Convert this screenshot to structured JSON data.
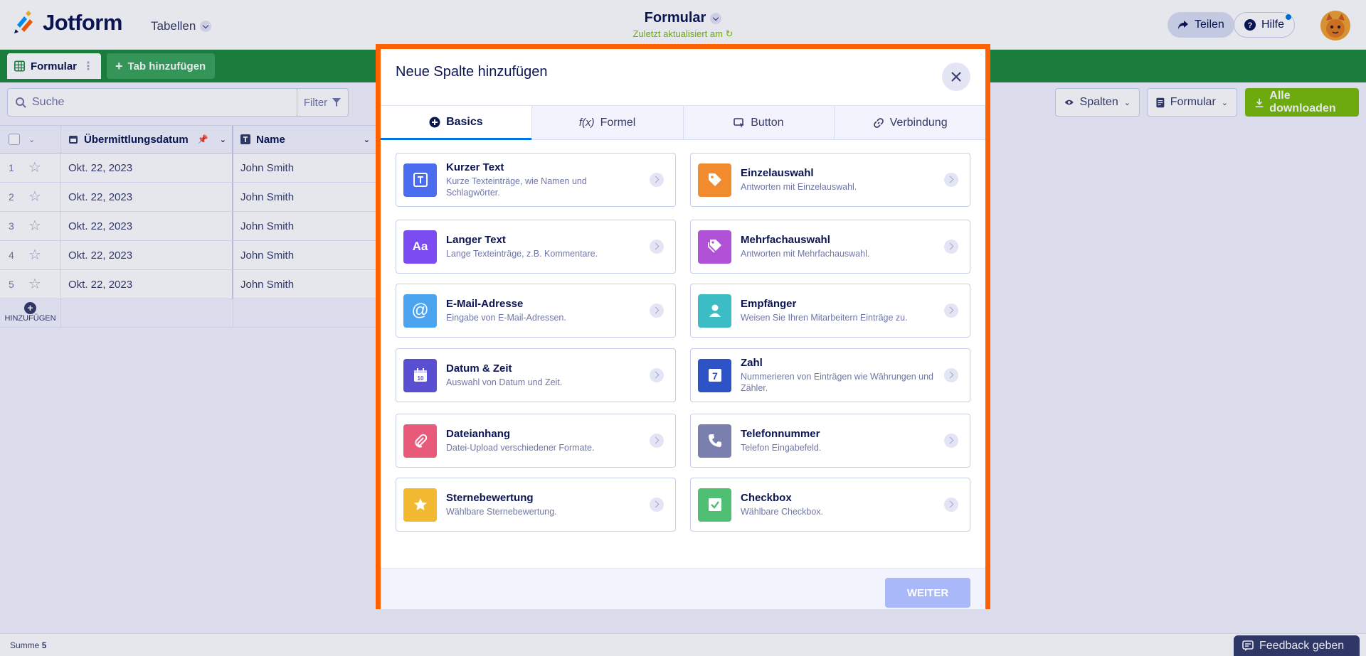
{
  "header": {
    "logo_text": "Jotform",
    "tables_menu": "Tabellen",
    "form_title": "Formular",
    "saved_status": "Zuletzt aktualisiert am",
    "share_label": "Teilen",
    "help_label": "Hilfe"
  },
  "tabs": {
    "current": "Formular",
    "add_label": "Tab hinzufügen"
  },
  "toolbar": {
    "search_placeholder": "Suche",
    "filter_label": "Filter",
    "columns_label": "Spalten",
    "form_view_label": "Formular",
    "download_label": "Alle downloaden"
  },
  "table": {
    "columns": [
      "Übermittlungsdatum",
      "Name"
    ],
    "rows": [
      {
        "num": "1",
        "date": "Okt. 22, 2023",
        "name": "John Smith"
      },
      {
        "num": "2",
        "date": "Okt. 22, 2023",
        "name": "John Smith"
      },
      {
        "num": "3",
        "date": "Okt. 22, 2023",
        "name": "John Smith"
      },
      {
        "num": "4",
        "date": "Okt. 22, 2023",
        "name": "John Smith"
      },
      {
        "num": "5",
        "date": "Okt. 22, 2023",
        "name": "John Smith"
      }
    ],
    "add_label": "HINZUFÜGEN"
  },
  "footer": {
    "sum_label": "Summe",
    "sum_value": "5",
    "feedback_label": "Feedback geben"
  },
  "modal": {
    "title": "Neue Spalte hinzufügen",
    "tabs": [
      {
        "label": "Basics",
        "icon": "plus-circle-icon"
      },
      {
        "label": "Formel",
        "icon": "formula-icon"
      },
      {
        "label": "Button",
        "icon": "button-icon"
      },
      {
        "label": "Verbindung",
        "icon": "link-icon"
      }
    ],
    "field_types": [
      {
        "title": "Kurzer Text",
        "desc": "Kurze Texteinträge, wie Namen und Schlagwörter.",
        "color": "#4c6cf0"
      },
      {
        "title": "Einzelauswahl",
        "desc": "Antworten mit Einzelauswahl.",
        "color": "#f08c2e"
      },
      {
        "title": "Langer Text",
        "desc": "Lange Texteinträge, z.B. Kommentare.",
        "color": "#7b4cf2"
      },
      {
        "title": "Mehrfachauswahl",
        "desc": "Antworten mit Mehrfachauswahl.",
        "color": "#b151d8"
      },
      {
        "title": "E-Mail-Adresse",
        "desc": "Eingabe von E-Mail-Adressen.",
        "color": "#4ba4f0"
      },
      {
        "title": "Empfänger",
        "desc": "Weisen Sie Ihren Mitarbeitern Einträge zu.",
        "color": "#3cbcc4"
      },
      {
        "title": "Datum & Zeit",
        "desc": "Auswahl von Datum und Zeit.",
        "color": "#5a4fd0"
      },
      {
        "title": "Zahl",
        "desc": "Nummerieren von Einträgen wie Währungen und Zähler.",
        "color": "#2e53c6"
      },
      {
        "title": "Dateianhang",
        "desc": "Datei-Upload verschiedener Formate.",
        "color": "#e85a7a"
      },
      {
        "title": "Telefonnummer",
        "desc": "Telefon Eingabefeld.",
        "color": "#7b7fae"
      },
      {
        "title": "Sternebewertung",
        "desc": "Wählbare Sternebewertung.",
        "color": "#f2b830"
      },
      {
        "title": "Checkbox",
        "desc": "Wählbare Checkbox.",
        "color": "#4fbf73"
      }
    ],
    "next_label": "WEITER"
  }
}
